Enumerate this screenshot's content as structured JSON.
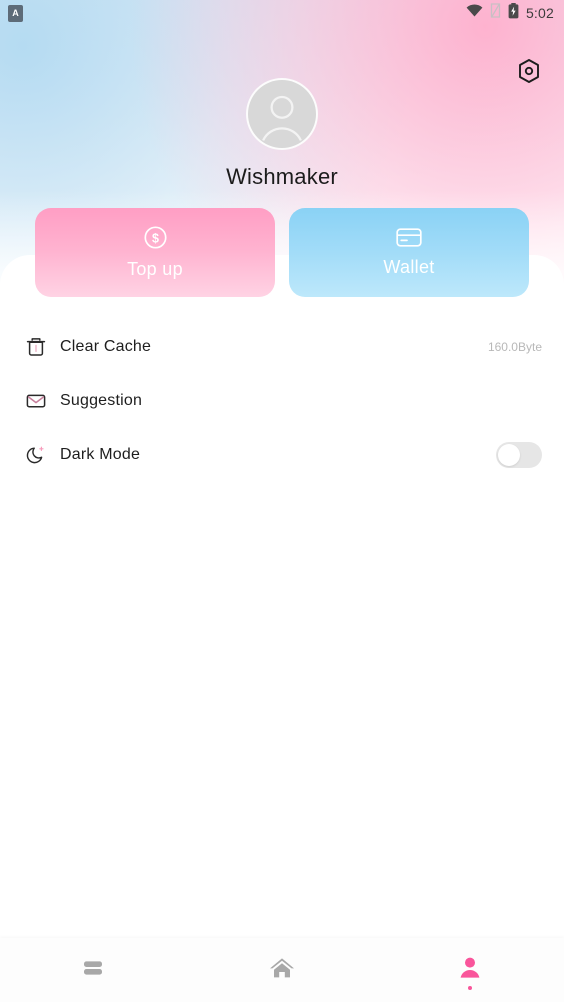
{
  "statusbar": {
    "app_badge_letter": "A",
    "app_badge_icon": "app-notification-icon",
    "wifi_icon": "wifi-icon",
    "signal_icon": "signal-off-icon",
    "battery_icon": "battery-charging-icon",
    "time": "5:02"
  },
  "header": {
    "settings_icon": "gear-icon",
    "avatar_icon": "avatar-person-icon",
    "username": "Wishmaker"
  },
  "actions": [
    {
      "label": "Top up",
      "icon": "dollar-circle-icon",
      "color": "#ffb3d0"
    },
    {
      "label": "Wallet",
      "icon": "credit-card-icon",
      "color": "#a2dcf8"
    }
  ],
  "menu": [
    {
      "label": "Clear Cache",
      "icon": "trash-icon",
      "value": "160.0Byte",
      "control": "value"
    },
    {
      "label": "Suggestion",
      "icon": "mail-icon",
      "value": "",
      "control": "none"
    },
    {
      "label": "Dark Mode",
      "icon": "moon-icon",
      "value": "",
      "control": "toggle",
      "toggle_on": false
    }
  ],
  "bottomnav": [
    {
      "name": "library",
      "icon": "library-icon",
      "active": false
    },
    {
      "name": "home",
      "icon": "home-icon",
      "active": false
    },
    {
      "name": "profile",
      "icon": "person-icon",
      "active": true
    }
  ],
  "colors": {
    "accent_pink": "#f9559b",
    "button_pink": "#ffb3d0",
    "button_blue": "#a2dcf8",
    "inactive_gray": "#a8a8a8",
    "text_primary": "#1e1e1e",
    "text_muted": "#b8b8b8"
  }
}
